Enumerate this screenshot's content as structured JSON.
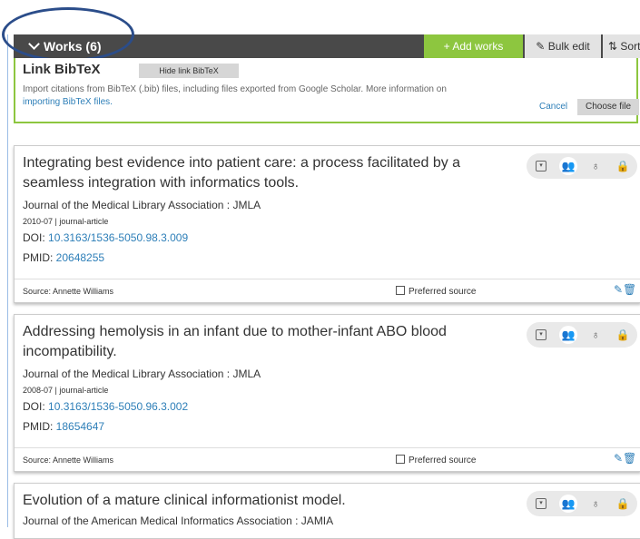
{
  "header": {
    "works_label": "Works (6)",
    "add_works_label": "+ Add works",
    "bulk_edit_label": "Bulk edit",
    "sort_label": "Sort"
  },
  "bibtex": {
    "title": "Link BibTeX",
    "hide_label": "Hide link BibTeX",
    "desc_prefix": "Import citations from BibTeX (.bib) files, including files exported from Google Scholar. More information on ",
    "desc_link": "importing BibTeX files.",
    "cancel_label": "Cancel",
    "choose_label": "Choose file"
  },
  "works": [
    {
      "title": "Integrating best evidence into patient care: a process facilitated by a seamless integration with informatics tools.",
      "journal": "Journal of the Medical Library Association : JMLA",
      "meta": "2010-07 | journal-article",
      "doi_label": "DOI: ",
      "doi": "10.3163/1536-5050.98.3.009",
      "pmid_label": "PMID: ",
      "pmid": "20648255",
      "source": "Source: Annette Williams",
      "preferred": "Preferred source"
    },
    {
      "title": "Addressing hemolysis in an infant due to mother-infant ABO blood incompatibility.",
      "journal": "Journal of the Medical Library Association : JMLA",
      "meta": "2008-07 | journal-article",
      "doi_label": "DOI: ",
      "doi": "10.3163/1536-5050.96.3.002",
      "pmid_label": "PMID: ",
      "pmid": "18654647",
      "source": "Source: Annette Williams",
      "preferred": "Preferred source"
    },
    {
      "title": "Evolution of a mature clinical informationist model.",
      "journal": "Journal of the American Medical Informatics Association : JAMIA"
    }
  ],
  "colors": {
    "accent_green": "#8dc63f",
    "header_dark": "#494949",
    "link_blue": "#2e7fb8"
  }
}
